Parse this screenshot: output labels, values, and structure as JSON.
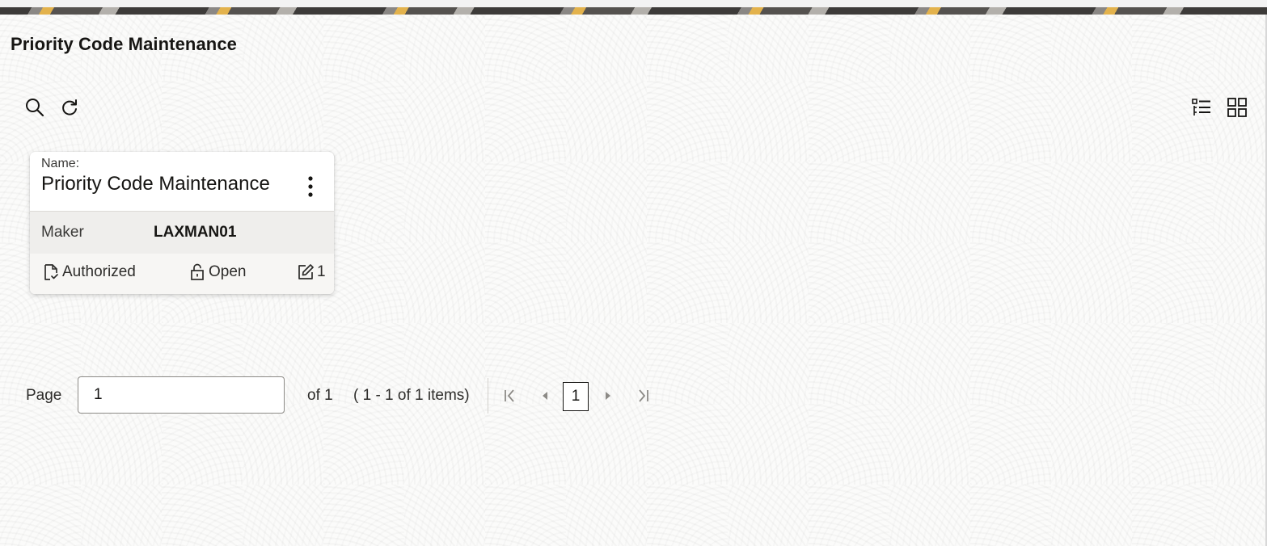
{
  "page": {
    "title": "Priority Code Maintenance"
  },
  "toolbar": {
    "left_icons": [
      "search-icon",
      "refresh-icon"
    ],
    "right_icons": [
      "list-view-icon",
      "tile-view-icon"
    ]
  },
  "card": {
    "name_caption": "Name:",
    "name_value": "Priority Code Maintenance",
    "maker_label": "Maker",
    "maker_value": "LAXMAN01",
    "auth_status": "Authorized",
    "record_status": "Open",
    "mod_count": "1",
    "icons": [
      "more-actions-icon",
      "authorized-doc-icon",
      "unlock-icon",
      "edit-icon"
    ]
  },
  "pagination": {
    "page_label": "Page",
    "page_input_value": "1",
    "of_text": "of 1",
    "range_text": "( 1 - 1 of 1 items)",
    "current_page": "1",
    "nav_icons": [
      "first-page-icon",
      "previous-page-icon",
      "next-page-icon",
      "last-page-icon"
    ]
  },
  "colors": {
    "text": "#161513",
    "muted_nav": "#8c8a86",
    "card_mid_bg": "#efeeec",
    "accent_banner": "#e3b24c"
  }
}
